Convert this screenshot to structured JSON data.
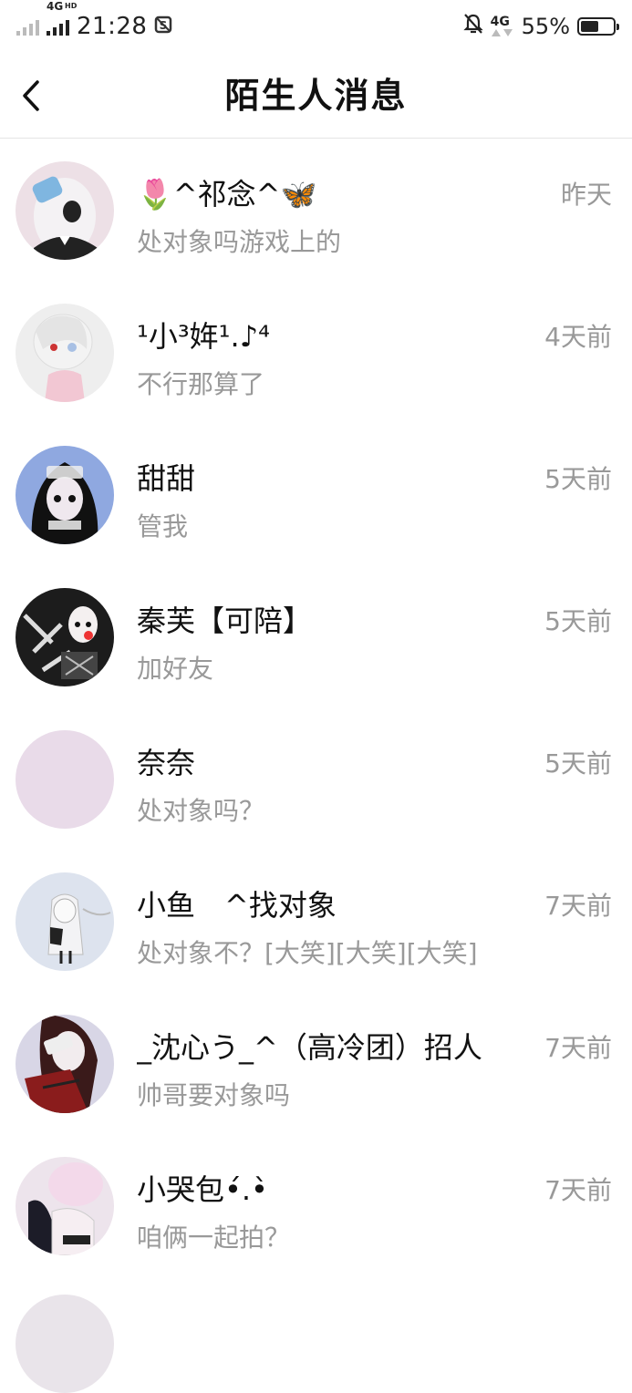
{
  "status_bar": {
    "network_primary": "4G",
    "network_primary_sup": "HD",
    "time": "21:28",
    "network_secondary": "4G",
    "battery_text": "55%",
    "battery_level": 0.55
  },
  "header": {
    "title": "陌生人消息",
    "back_icon": "chevron-left-icon"
  },
  "messages": [
    {
      "name": "🌷^祁念^🦋",
      "preview": "处对象吗游戏上的",
      "time": "昨天",
      "avatar_color": "#ede0e6"
    },
    {
      "name": "¹小³姩¹.♪⁴",
      "preview": "不行那算了",
      "time": "4天前",
      "avatar_color": "#eeeeee"
    },
    {
      "name": "甜甜",
      "preview": "管我",
      "time": "5天前",
      "avatar_color": "#8fa8e0"
    },
    {
      "name": "秦芙【可陪】",
      "preview": "加好友",
      "time": "5天前",
      "avatar_color": "#1c1c1c"
    },
    {
      "name": "奈奈",
      "preview": "处对象吗？",
      "time": "5天前",
      "avatar_color": "#e9dbe9"
    },
    {
      "name": "小鱼　^找对象",
      "preview": "处对象不？[大笑][大笑][大笑]",
      "time": "7天前",
      "avatar_color": "#dde3ee"
    },
    {
      "name": "_沈心う_^（高冷团）招人",
      "preview": "帅哥要对象吗",
      "time": "7天前",
      "avatar_color": "#d8d6e6"
    },
    {
      "name": "小哭包•́.•̀",
      "preview": "咱俩一起拍？",
      "time": "7天前",
      "avatar_color": "#ede4ec"
    }
  ]
}
